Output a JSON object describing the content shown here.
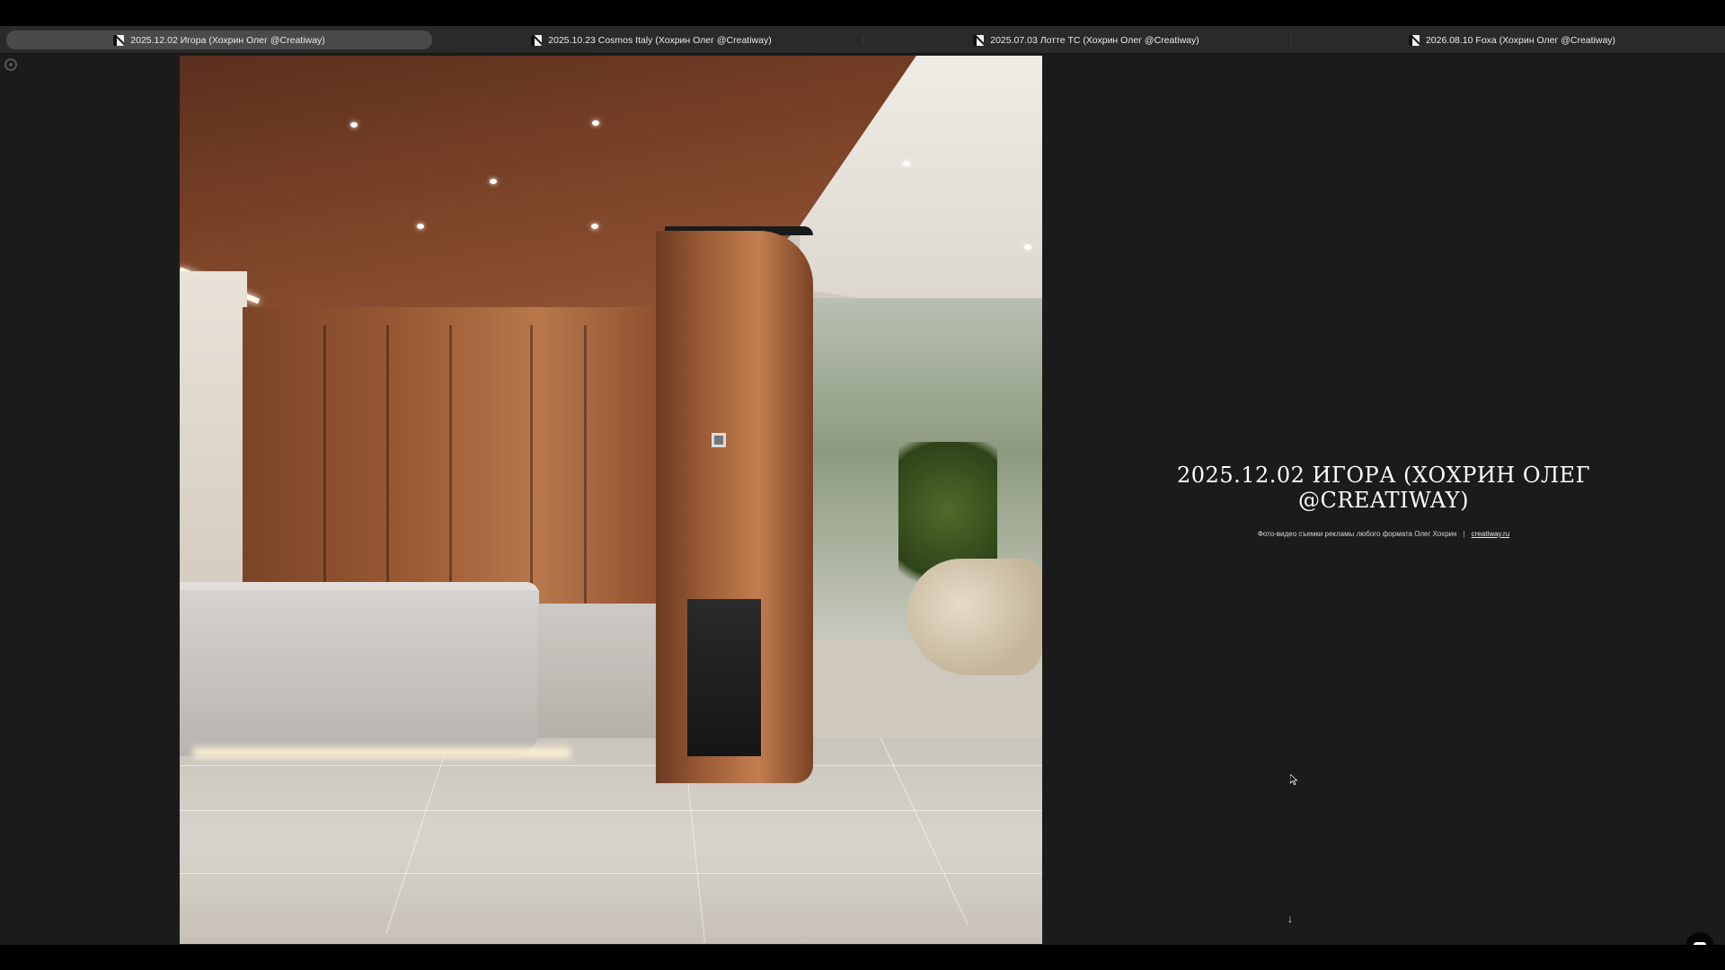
{
  "tabs": [
    {
      "label": "2025.12.02 Игора (Хохрин Олег @Creatiway)",
      "active": true
    },
    {
      "label": "2025.10.23 Cosmos Italy (Хохрин Олег @Creatiway)",
      "active": false
    },
    {
      "label": "2025.07.03 Лотте ТС (Хохрин Олег @Creatiway)",
      "active": false
    },
    {
      "label": "2026.08.10 Foxa (Хохрин Олег @Creatiway)",
      "active": false
    }
  ],
  "main": {
    "title_line1": "2025.12.02 Игора (Хохрин Олег",
    "title_line2": "@Creatiway)",
    "subtitle": "Фото-видео съемки рекламы любого формата Олег Хохрин",
    "separator": "|",
    "link": "creatiway.ru",
    "scroll_arrow": "↓"
  },
  "icons": {
    "tab_favicon": "site-favicon-icon",
    "side": "settings-gear-icon",
    "chat": "chat-bubble-icon",
    "scroll": "arrow-down-icon"
  },
  "colors": {
    "background": "#1b1b1b",
    "tabbar": "#2a2a2a",
    "active_tab": "#4a4a4a",
    "text": "#ffffff"
  }
}
